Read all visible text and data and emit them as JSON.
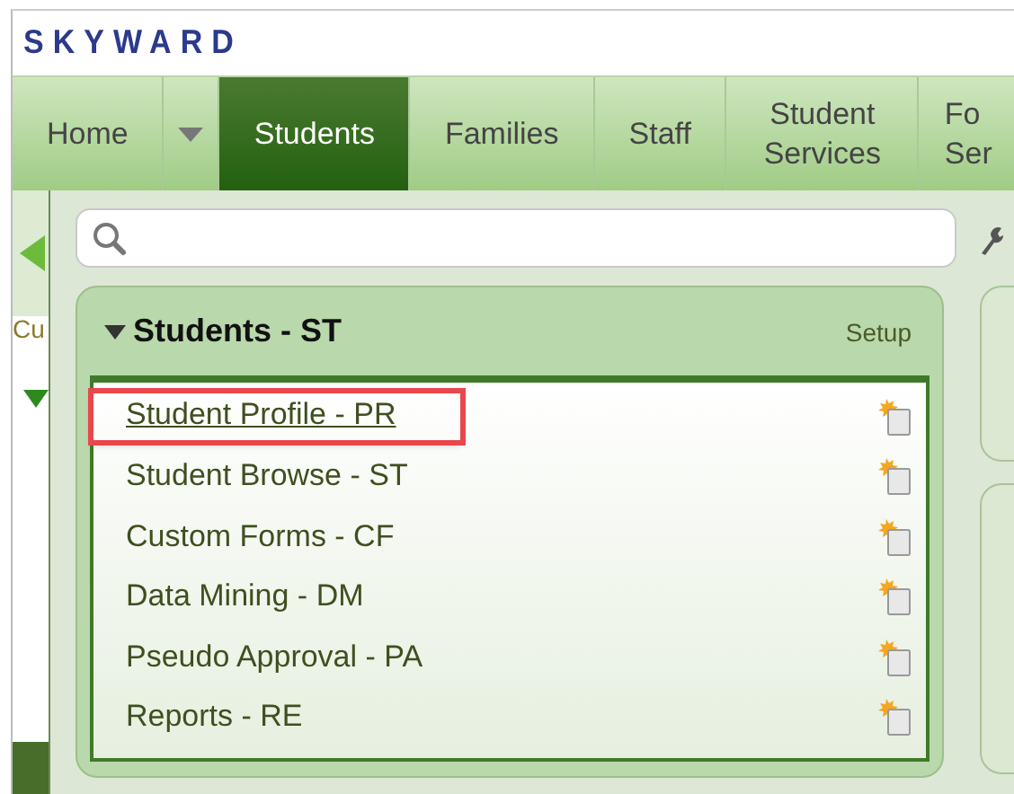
{
  "logo": "SKYWARD",
  "nav_tabs": [
    {
      "label": "Home",
      "kind": "link",
      "selected": false
    },
    {
      "kind": "dropdown",
      "selected": false
    },
    {
      "label": "Students",
      "kind": "link",
      "selected": true
    },
    {
      "label": "Families",
      "kind": "link",
      "selected": false
    },
    {
      "label": "Staff",
      "kind": "link",
      "selected": false
    },
    {
      "label": "Student Services",
      "kind": "link",
      "selected": false
    },
    {
      "label": "Fo Ser",
      "kind": "link",
      "selected": false
    }
  ],
  "side_strip": {
    "label": "Cu"
  },
  "card": {
    "title": "Students - ST",
    "expanded": true,
    "action": "Setup",
    "items": [
      {
        "label": "Student Profile - PR",
        "highlighted": true
      },
      {
        "label": "Student Browse - ST",
        "highlighted": false
      },
      {
        "label": "Custom Forms - CF",
        "highlighted": false
      },
      {
        "label": "Data Mining - DM",
        "highlighted": false
      },
      {
        "label": "Pseudo Approval - PA",
        "highlighted": false
      },
      {
        "label": "Reports - RE",
        "highlighted": false
      }
    ]
  }
}
